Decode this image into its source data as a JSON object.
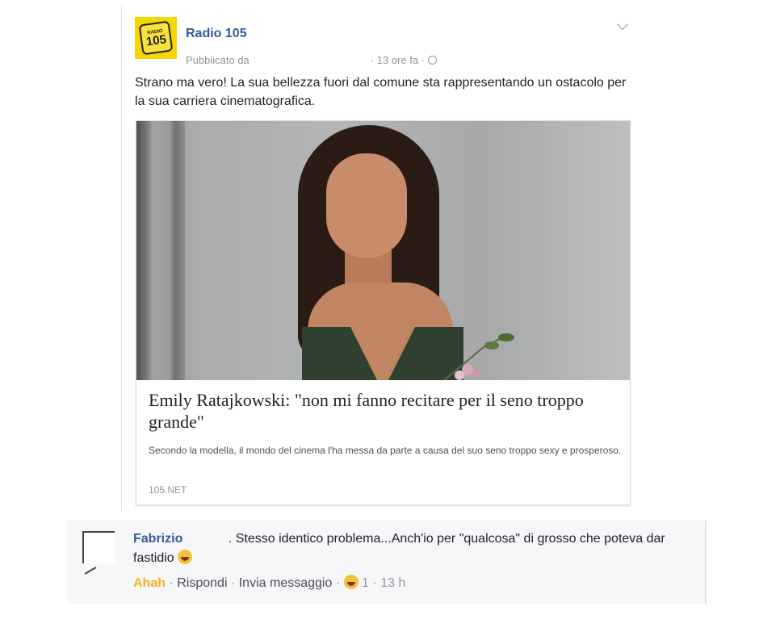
{
  "post": {
    "page_name": "Radio 105",
    "published_by": "Pubblicato da",
    "time": "· 13 ore fa ·",
    "logo_top": "RADIO",
    "logo_num": "105",
    "text": "Strano ma vero! La sua bellezza fuori dal comune sta rappresentando un ostacolo per la sua carriera cinematografica."
  },
  "link": {
    "title": "Emily Ratajkowski: \"non mi fanno recitare per il seno troppo grande\"",
    "description": "Secondo la modella, il mondo del cinema l'ha messa da parte a causa del suo seno troppo sexy e prosperoso.",
    "domain": "105.NET"
  },
  "comment": {
    "author": "Fabrizio",
    "author_suffix": ".",
    "text_line": "Stesso identico problema...Anch'io per \"qualcosa\" di grosso che poteva dar fastidio",
    "reaction_label": "Ahah",
    "sep1": "·",
    "reply_label": "Rispondi",
    "sep2": "·",
    "message_label": "Invia messaggio",
    "sep3": "·",
    "reaction_count": "1",
    "sep4": "·",
    "time": "13 h"
  }
}
